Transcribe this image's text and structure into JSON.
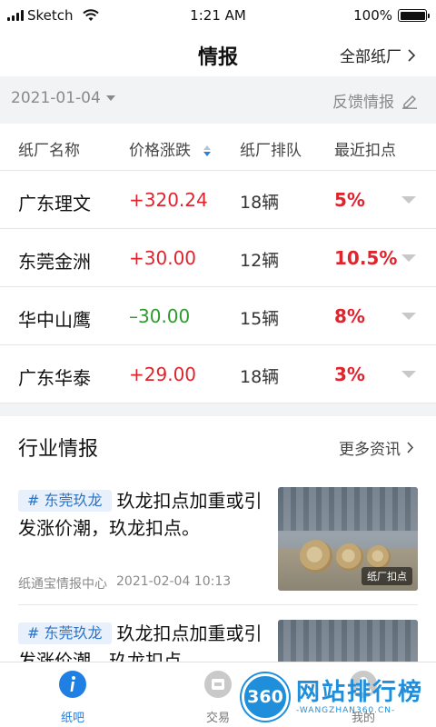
{
  "status_bar": {
    "carrier": "Sketch",
    "time": "1:21 AM",
    "battery": "100%"
  },
  "nav": {
    "title": "情报",
    "right_label": "全部纸厂"
  },
  "filter": {
    "date": "2021-01-04",
    "feedback_label": "反馈情报"
  },
  "table": {
    "headers": [
      "纸厂名称",
      "价格涨跌",
      "纸厂排队",
      "最近扣点"
    ],
    "rows": [
      {
        "name": "广东理文",
        "change": "+320.24",
        "queue": "18辆",
        "deduction": "5%"
      },
      {
        "name": "东莞金洲",
        "change": "+30.00",
        "queue": "12辆",
        "deduction": "10.5%"
      },
      {
        "name": "华中山鹰",
        "change": "–30.00",
        "queue": "15辆",
        "deduction": "8%"
      },
      {
        "name": "广东华泰",
        "change": "+29.00",
        "queue": "18辆",
        "deduction": "3%"
      }
    ]
  },
  "industry": {
    "title": "行业情报",
    "more_label": "更多资讯",
    "news": [
      {
        "tag": "# 东莞玖龙",
        "title": "玖龙扣点加重或引发涨价潮，玖龙扣点。",
        "source": "纸通宝情报中心",
        "time": "2021-02-04 10:13",
        "image_badge": "纸厂扣点"
      },
      {
        "tag": "# 东莞玖龙",
        "title": "玖龙扣点加重或引发涨价潮，玖龙扣点。"
      }
    ]
  },
  "tabs": [
    {
      "label": "纸吧",
      "icon": "info-icon",
      "active": true
    },
    {
      "label": "交易",
      "icon": "trade-icon",
      "active": false
    },
    {
      "label": "我的",
      "icon": "profile-icon",
      "active": false
    }
  ],
  "watermark": {
    "logo": "360",
    "title": "网站排行榜",
    "subtitle": "-WANGZHAN360.CN-"
  },
  "colors": {
    "accent": "#1f7fe3",
    "up": "#e0242e",
    "down": "#2e9b2e",
    "tag_bg": "#e8f1fb",
    "tag_text": "#2a72c7"
  }
}
